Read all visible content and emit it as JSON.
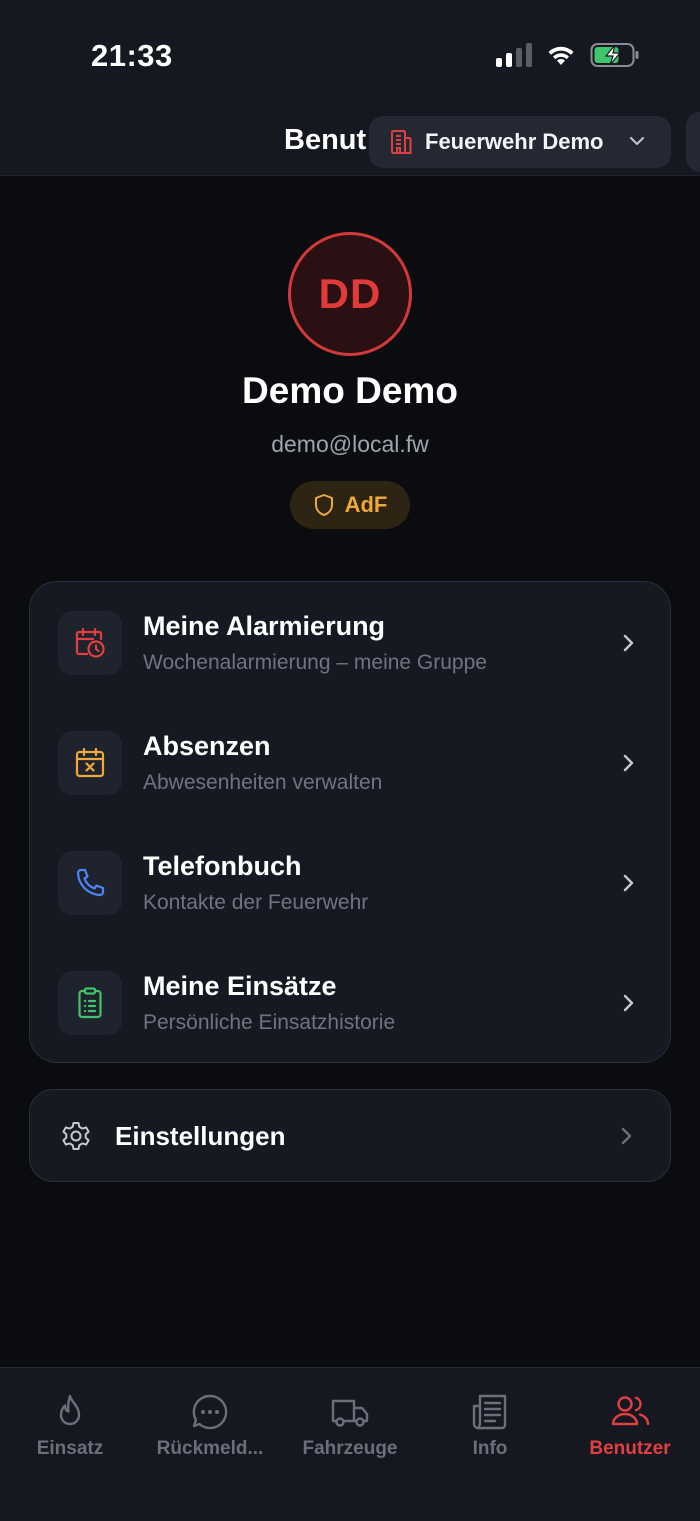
{
  "status_bar": {
    "time": "21:33"
  },
  "header": {
    "title": "Benut",
    "tenant": "Feuerwehr Demo"
  },
  "profile": {
    "initials": "DD",
    "name": "Demo Demo",
    "email": "demo@local.fw",
    "role": "AdF"
  },
  "menu": {
    "items": [
      {
        "title": "Meine Alarmierung",
        "subtitle": "Wochenalarmierung – meine Gruppe",
        "icon": "calendar-clock-icon",
        "color": "#e04040"
      },
      {
        "title": "Absenzen",
        "subtitle": "Abwesenheiten verwalten",
        "icon": "calendar-x-icon",
        "color": "#f0a83a"
      },
      {
        "title": "Telefonbuch",
        "subtitle": "Kontakte der Feuerwehr",
        "icon": "phone-icon",
        "color": "#4f86f7"
      },
      {
        "title": "Meine Einsätze",
        "subtitle": "Persönliche Einsatzhistorie",
        "icon": "clipboard-list-icon",
        "color": "#3fc56b"
      }
    ]
  },
  "settings": {
    "title": "Einstellungen",
    "icon": "gear-icon"
  },
  "bottom_nav": {
    "items": [
      {
        "label": "Einsatz",
        "icon": "flame-icon"
      },
      {
        "label": "Rückmeld...",
        "icon": "chat-bubble-icon"
      },
      {
        "label": "Fahrzeuge",
        "icon": "truck-icon"
      },
      {
        "label": "Info",
        "icon": "newspaper-icon"
      },
      {
        "label": "Benutzer",
        "icon": "users-icon"
      }
    ],
    "active": "Benutzer"
  },
  "colors": {
    "accent": "#e04040",
    "background": "#0b0c10",
    "card": "#151922",
    "badge_text": "#f0a83a"
  }
}
